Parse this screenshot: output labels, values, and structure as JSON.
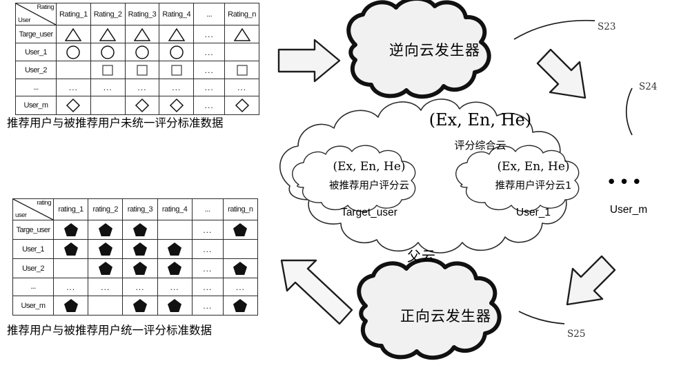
{
  "diagram": {
    "title_top_table_caption": "推荐用户与被推荐用户未统一评分标准数据",
    "title_bottom_table_caption": "推荐用户与被推荐用户统一评分标准数据"
  },
  "top_table": {
    "corner": {
      "top_label": "Rating",
      "bottom_label": "User"
    },
    "columns": [
      "Rating_1",
      "Rating_2",
      "Rating_3",
      "Rating_4",
      "...",
      "Rating_n"
    ],
    "rows": [
      {
        "label": "Targe_user",
        "cells": [
          "triangle",
          "triangle",
          "triangle",
          "triangle",
          "dots",
          "triangle"
        ]
      },
      {
        "label": "User_1",
        "cells": [
          "circle",
          "circle",
          "circle",
          "circle",
          "dots",
          ""
        ]
      },
      {
        "label": "User_2",
        "cells": [
          "",
          "square",
          "square",
          "square",
          "dots",
          "square"
        ]
      },
      {
        "label": "...",
        "cells": [
          "dots",
          "dots",
          "dots",
          "dots",
          "dots",
          "dots"
        ]
      },
      {
        "label": "User_m",
        "cells": [
          "diamond",
          "",
          "diamond",
          "diamond",
          "dots",
          "diamond"
        ]
      }
    ]
  },
  "bottom_table": {
    "corner": {
      "top_label": "rating",
      "bottom_label": "user"
    },
    "columns": [
      "rating_1",
      "rating_2",
      "rating_3",
      "rating_4",
      "...",
      "rating_n"
    ],
    "rows": [
      {
        "label": "Targe_user",
        "cells": [
          "pentagon",
          "pentagon",
          "pentagon",
          "",
          "dots",
          "pentagon"
        ]
      },
      {
        "label": "User_1",
        "cells": [
          "pentagon",
          "pentagon",
          "pentagon",
          "pentagon",
          "dots",
          ""
        ]
      },
      {
        "label": "User_2",
        "cells": [
          "",
          "pentagon",
          "pentagon",
          "pentagon",
          "dots",
          "pentagon"
        ]
      },
      {
        "label": "...",
        "cells": [
          "dots",
          "dots",
          "dots",
          "dots",
          "dots",
          "dots"
        ]
      },
      {
        "label": "User_m",
        "cells": [
          "pentagon",
          "",
          "pentagon",
          "pentagon",
          "dots",
          "pentagon"
        ]
      }
    ]
  },
  "clouds": {
    "reverse_generator": {
      "label": "逆向云发生器",
      "step": "S23"
    },
    "forward_generator": {
      "label": "正向云发生器",
      "step": "S25"
    },
    "parent_cloud": {
      "step": "S24",
      "exenhe": "(Ex, En, He)",
      "name": "评分综合云",
      "bottom_label": "父云",
      "ellipsis": "•••",
      "children": [
        {
          "exenhe": "(Ex, En, He)",
          "name": "被推荐用户评分云",
          "user": "Target_user"
        },
        {
          "exenhe": "(Ex, En, He)",
          "name": "推荐用户评分云1",
          "user": "User_1"
        }
      ],
      "last_user": "User_m"
    }
  },
  "colors": {
    "stroke": "#1a1a1a",
    "cloud_fill": "#f2f2f2",
    "arrow_fill": "#f4f4f4",
    "text": "#111111"
  }
}
